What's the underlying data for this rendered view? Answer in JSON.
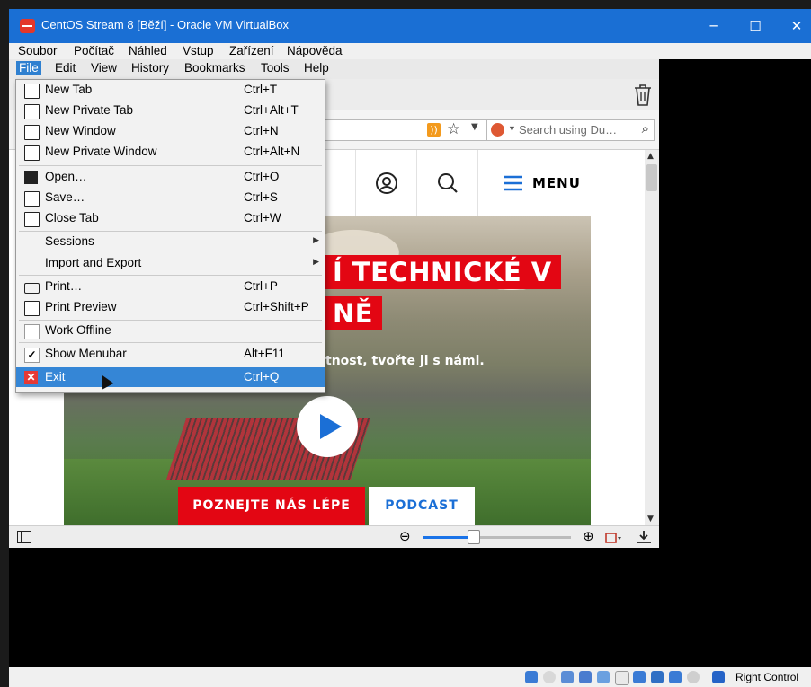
{
  "window": {
    "title": "CentOS Stream 8 [Běží] - Oracle VM VirtualBox",
    "minimize": "─",
    "maximize": "☐",
    "close": "✕"
  },
  "vbox_menu": [
    "Soubor",
    "Počítač",
    "Náhled",
    "Vstup",
    "Zařízení",
    "Nápověda"
  ],
  "ff_menu": [
    "File",
    "Edit",
    "View",
    "History",
    "Bookmarks",
    "Tools",
    "Help"
  ],
  "search": {
    "placeholder": "Search using Du…"
  },
  "file_menu": [
    {
      "label": "New Tab",
      "shortcut": "Ctrl+T"
    },
    {
      "label": "New Private Tab",
      "shortcut": "Ctrl+Alt+T"
    },
    {
      "label": "New Window",
      "shortcut": "Ctrl+N"
    },
    {
      "label": "New Private Window",
      "shortcut": "Ctrl+Alt+N"
    },
    {
      "label": "Open…",
      "shortcut": "Ctrl+O"
    },
    {
      "label": "Save…",
      "shortcut": "Ctrl+S"
    },
    {
      "label": "Close Tab",
      "shortcut": "Ctrl+W"
    },
    {
      "label": "Sessions",
      "shortcut": ""
    },
    {
      "label": "Import and Export",
      "shortcut": ""
    },
    {
      "label": "Print…",
      "shortcut": "Ctrl+P"
    },
    {
      "label": "Print Preview",
      "shortcut": "Ctrl+Shift+P"
    },
    {
      "label": "Work Offline",
      "shortcut": ""
    },
    {
      "label": "Show Menubar",
      "shortcut": "Alt+F11"
    },
    {
      "label": "Exit",
      "shortcut": "Ctrl+Q"
    }
  ],
  "site": {
    "menu_label": "MENU",
    "headline_1": "Í TECHNICKÉ V",
    "headline_2": "NĚ",
    "tagline": "tnost, tvořte ji s námi.",
    "cta_primary": "POZNEJTE NÁS LÉPE",
    "cta_secondary": "PODCAST"
  },
  "zoom": {
    "fill_fraction": 0.35
  },
  "vbox_status": {
    "host_key": "Right Control"
  },
  "colors": {
    "accent": "#1a6fd4",
    "brand_red": "#e30613",
    "menu_highlight": "#3586d6"
  }
}
